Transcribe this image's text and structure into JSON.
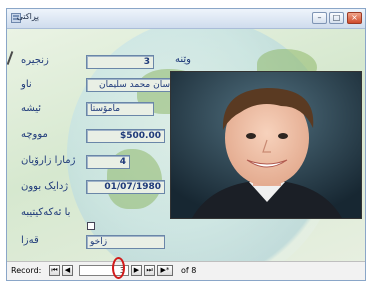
{
  "window": {
    "title": "پڕاکتی",
    "min_label": "–",
    "max_label": "□",
    "close_label": "×"
  },
  "form": {
    "photo_label": "وێنە",
    "fields": [
      {
        "label": "زنجیرە",
        "value": "3"
      },
      {
        "label": "ناو",
        "value": "سان محمد سليمان"
      },
      {
        "label": "ئیشە",
        "value": "مامۆستا"
      },
      {
        "label": "مووچە",
        "value": "$500.00"
      },
      {
        "label": "ژمارا زارۆيان",
        "value": "4"
      },
      {
        "label": "ژدایک بوون",
        "value": "01/07/1980"
      },
      {
        "label": "با ئەکەکیتیبە",
        "value": ""
      },
      {
        "label": "قەزا",
        "value": "زاخو"
      }
    ],
    "married_checked": false
  },
  "navigation": {
    "record_label": "Record:",
    "first_icon": "first-record-icon",
    "prev_icon": "previous-record-icon",
    "current": "3",
    "next_icon": "next-record-icon",
    "last_icon": "last-record-icon",
    "new_icon": "new-record-icon",
    "total_text": "of 8"
  },
  "colors": {
    "label_text": "#1f3a7a",
    "form_background": "#d6e8cf",
    "highlight_circle": "#d11a1a"
  }
}
